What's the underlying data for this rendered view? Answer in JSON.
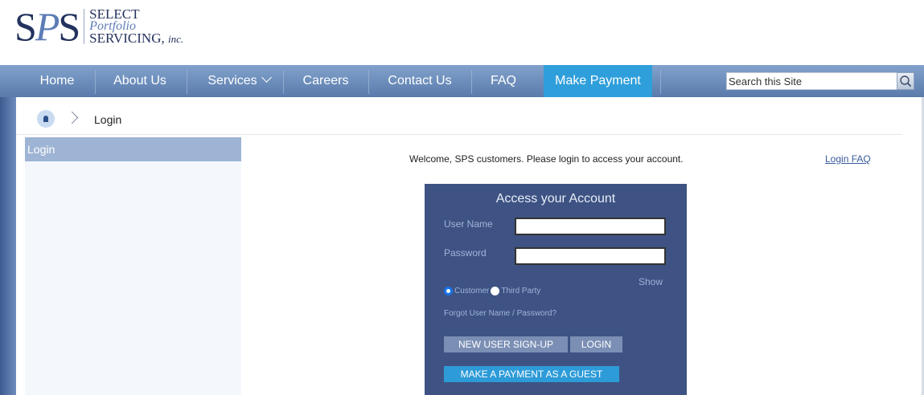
{
  "logo": {
    "s1": "S",
    "p": "P",
    "s2": "S",
    "line1": "SELECT",
    "line2": "Portfolio",
    "line3": "SERVICING,",
    "line3_suffix": "inc."
  },
  "nav": {
    "items": [
      {
        "label": "Home"
      },
      {
        "label": "About Us"
      },
      {
        "label": "Services"
      },
      {
        "label": "Careers"
      },
      {
        "label": "Contact Us"
      },
      {
        "label": "FAQ"
      },
      {
        "label": "Make Payment",
        "active": true
      }
    ],
    "search_placeholder": "Search this Site"
  },
  "breadcrumb": {
    "current": "Login"
  },
  "sidebar": {
    "heading": "Login"
  },
  "main": {
    "welcome": "Welcome, SPS customers. Please login to access your account.",
    "faq_link": "Login FAQ"
  },
  "login_panel": {
    "title": "Access your Account",
    "username_label": "User Name",
    "username_value": "",
    "password_label": "Password",
    "password_value": "",
    "show_label": "Show",
    "radio_customer": "Customer",
    "radio_third_party": "Third Party",
    "selected": "Customer",
    "forgot_link": "Forgot User Name / Password?",
    "signup_button": "NEW USER SIGN-UP",
    "login_button": "LOGIN",
    "guest_button": "MAKE A PAYMENT AS A GUEST"
  },
  "colors": {
    "nav_gradient_top": "#82a2cc",
    "nav_active": "#2f9fdb",
    "panel_bg": "#3e5384",
    "brand_navy": "#23325e"
  }
}
